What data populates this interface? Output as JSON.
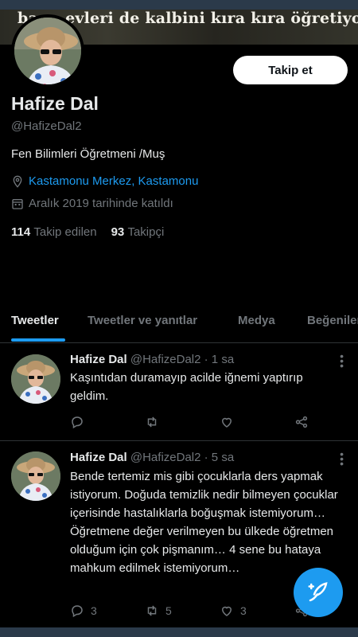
{
  "banner_text": "ba ... evleri de kalbini kıra kıra öğretiyor.",
  "profile": {
    "name": "Hafize Dal",
    "handle": "@HafizeDal2",
    "bio": "Fen Bilimleri Öğretmeni /Muş",
    "location": "Kastamonu Merkez, Kastamonu",
    "joined": "Aralık 2019 tarihinde katıldı",
    "following_count": "114",
    "following_label": "Takip edilen",
    "followers_count": "93",
    "followers_label": "Takipçi",
    "follow_button": "Takip et"
  },
  "tabs": [
    {
      "label": "Tweetler"
    },
    {
      "label": "Tweetler ve yanıtlar"
    },
    {
      "label": "Medya"
    },
    {
      "label": "Beğeniler"
    }
  ],
  "tweets": [
    {
      "name": "Hafize Dal",
      "handle": "@HafizeDal2",
      "time": "· 1 sa",
      "text": "Kaşıntıdan duramayıp acilde iğnemi yaptırıp geldim.",
      "replies": "",
      "retweets": "",
      "likes": ""
    },
    {
      "name": "Hafize Dal",
      "handle": "@HafizeDal2",
      "time": "· 5 sa",
      "text": "Bende tertemiz mis gibi çocuklarla ders yapmak istiyorum. Doğuda temizlik nedir bilmeyen çocuklar içerisinde hastalıklarla boğuşmak istemiyorum… Öğretmene değer verilmeyen bu ülkede öğretmen olduğum için çok pişmanım… 4 sene bu hataya mahkum edilmek istemiyorum…",
      "replies": "3",
      "retweets": "5",
      "likes": "3"
    }
  ],
  "colors": {
    "accent": "#1d9bf0",
    "background": "#000000",
    "muted": "#71767b"
  },
  "icons": [
    "location-pin-icon",
    "calendar-icon",
    "reply-icon",
    "retweet-icon",
    "like-icon",
    "share-icon",
    "more-icon",
    "compose-icon"
  ]
}
